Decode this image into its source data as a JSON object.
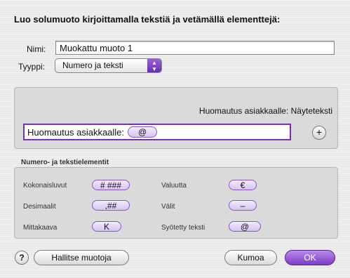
{
  "dialog": {
    "heading": "Luo solumuoto kirjoittamalla tekstiä ja vetämällä elementtejä:"
  },
  "name": {
    "label": "Nimi:",
    "value": "Muokattu muoto 1"
  },
  "type": {
    "label": "Tyyppi:",
    "value": "Numero ja teksti"
  },
  "format": {
    "preview": "Huomautus asiakkaalle: Näyteteksti",
    "text": "Huomautus asiakkaalle:",
    "token": "@",
    "add_symbol": "+"
  },
  "elements": {
    "title": "Numero- ja tekstielementit",
    "items": [
      {
        "label": "Kokonaisluvut",
        "token": "# ###"
      },
      {
        "label": "Valuutta",
        "token": "€"
      },
      {
        "label": "Desimaalit",
        "token": ",##"
      },
      {
        "label": "Välit",
        "token": "–"
      },
      {
        "label": "Mittakaava",
        "token": "K"
      },
      {
        "label": "Syötetty teksti",
        "token": "@"
      }
    ]
  },
  "buttons": {
    "help": "?",
    "manage": "Hallitse muotoja",
    "cancel": "Kumoa",
    "ok": "OK"
  },
  "colors": {
    "accent": "#7b2fb8",
    "token_border": "#8c55c4"
  }
}
